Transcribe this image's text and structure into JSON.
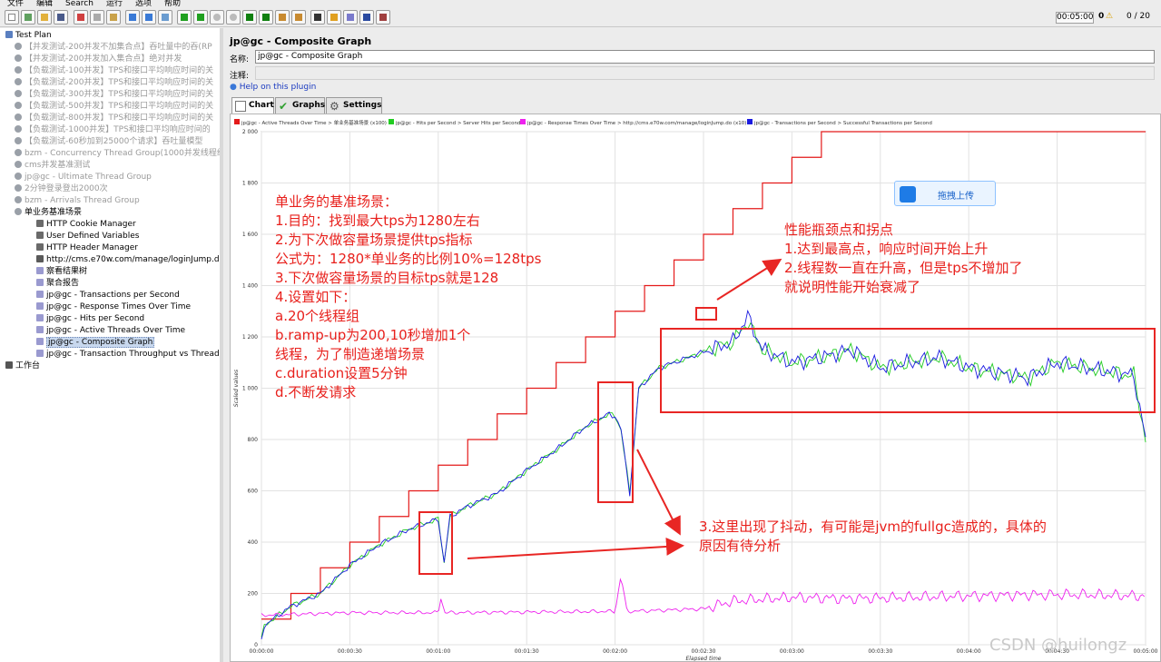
{
  "menu": [
    "文件",
    "编辑",
    "Search",
    "运行",
    "选项",
    "帮助"
  ],
  "toolbar": {
    "timer": "00:05:00",
    "warnings": "0",
    "threads": "0 / 20"
  },
  "tree": [
    {
      "label": "Test Plan",
      "indent": 0,
      "disabled": false,
      "icon": "test-plan-icon"
    },
    {
      "label": "【并发测试-200并发不加集合点】吞吐量中的吞(RP",
      "indent": 1,
      "disabled": true,
      "icon": "thread-group-icon"
    },
    {
      "label": "【并发测试-200并发加入集合点】绝对并发",
      "indent": 1,
      "disabled": true,
      "icon": "thread-group-icon"
    },
    {
      "label": "【负载测试-100并发】TPS和接口平均响应时间的关",
      "indent": 1,
      "disabled": true,
      "icon": "thread-group-icon"
    },
    {
      "label": "【负载测试-200并发】TPS和接口平均响应时间的关",
      "indent": 1,
      "disabled": true,
      "icon": "thread-group-icon"
    },
    {
      "label": "【负载测试-300并发】TPS和接口平均响应时间的关",
      "indent": 1,
      "disabled": true,
      "icon": "thread-group-icon"
    },
    {
      "label": "【负载测试-500并发】TPS和接口平均响应时间的关",
      "indent": 1,
      "disabled": true,
      "icon": "thread-group-icon"
    },
    {
      "label": "【负载测试-800并发】TPS和接口平均响应时间的关",
      "indent": 1,
      "disabled": true,
      "icon": "thread-group-icon"
    },
    {
      "label": "【负载测试-1000并发】TPS和接口平均响应时间的",
      "indent": 1,
      "disabled": true,
      "icon": "thread-group-icon"
    },
    {
      "label": "【负载测试-60秒加到25000个请求】吞吐量模型",
      "indent": 1,
      "disabled": true,
      "icon": "thread-group-icon"
    },
    {
      "label": "bzm - Concurrency Thread Group(1000并发线程组)",
      "indent": 1,
      "disabled": true,
      "icon": "thread-group-icon"
    },
    {
      "label": "cms并发基准测试",
      "indent": 1,
      "disabled": true,
      "icon": "thread-group-icon"
    },
    {
      "label": "jp@gc - Ultimate Thread Group",
      "indent": 1,
      "disabled": true,
      "icon": "thread-group-icon"
    },
    {
      "label": "2分钟登录登出2000次",
      "indent": 1,
      "disabled": true,
      "icon": "thread-group-icon"
    },
    {
      "label": "bzm - Arrivals Thread Group",
      "indent": 1,
      "disabled": true,
      "icon": "thread-group-icon"
    },
    {
      "label": "单业务基准场景",
      "indent": 1,
      "disabled": false,
      "icon": "thread-group-icon"
    },
    {
      "label": "HTTP Cookie Manager",
      "indent": 2,
      "disabled": false,
      "icon": "config-icon"
    },
    {
      "label": "User Defined Variables",
      "indent": 2,
      "disabled": false,
      "icon": "config-icon"
    },
    {
      "label": "HTTP Header Manager",
      "indent": 2,
      "disabled": false,
      "icon": "config-icon"
    },
    {
      "label": "http://cms.e70w.com/manage/loginJump.do",
      "indent": 2,
      "disabled": false,
      "icon": "sampler-icon"
    },
    {
      "label": "察看结果树",
      "indent": 2,
      "disabled": false,
      "icon": "listener-icon"
    },
    {
      "label": "聚合报告",
      "indent": 2,
      "disabled": false,
      "icon": "listener-icon"
    },
    {
      "label": "jp@gc - Transactions per Second",
      "indent": 2,
      "disabled": false,
      "icon": "listener-icon"
    },
    {
      "label": "jp@gc - Response Times Over Time",
      "indent": 2,
      "disabled": false,
      "icon": "listener-icon"
    },
    {
      "label": "jp@gc - Hits per Second",
      "indent": 2,
      "disabled": false,
      "icon": "listener-icon"
    },
    {
      "label": "jp@gc - Active Threads Over Time",
      "indent": 2,
      "disabled": false,
      "icon": "listener-icon"
    },
    {
      "label": "jp@gc - Composite Graph",
      "indent": 2,
      "disabled": false,
      "icon": "listener-icon",
      "selected": true
    },
    {
      "label": "jp@gc - Transaction Throughput vs Threads",
      "indent": 2,
      "disabled": false,
      "icon": "listener-icon"
    },
    {
      "label": "工作台",
      "indent": 0,
      "disabled": false,
      "icon": "workbench-icon"
    }
  ],
  "panel": {
    "title": "jp@gc - Composite Graph",
    "name_label": "名称:",
    "name_value": "jp@gc - Composite Graph",
    "comment_label": "注释:",
    "help": "Help on this plugin",
    "tabs": [
      "Chart",
      "Graphs",
      "Settings"
    ]
  },
  "chart_data": {
    "type": "line",
    "ylabel": "Scaled values",
    "xlabel": "Elapsed time",
    "ylim": [
      0,
      2000
    ],
    "yticks": [
      "0",
      "200",
      "400",
      "600",
      "800",
      "1 000",
      "1 200",
      "1 400",
      "1 600",
      "1 800",
      "2 000"
    ],
    "xticks": [
      "00:00:00",
      "00:00:30",
      "00:01:00",
      "00:01:30",
      "00:02:00",
      "00:02:30",
      "00:03:00",
      "00:03:30",
      "00:04:00",
      "00:04:30",
      "00:05:00"
    ],
    "xlim_seconds": [
      0,
      300
    ],
    "grid": true,
    "legend_placement": "top",
    "series": [
      {
        "name": "jp@gc - Active Threads Over Time > 单业务基准场景 (x100)",
        "color": "#e41a1a",
        "step_seconds": 10,
        "step_value": 100,
        "max_value": 2000
      },
      {
        "name": "jp@gc - Hits per Second > Server Hits per Second",
        "color": "#22cc22",
        "trend": [
          [
            0,
            20
          ],
          [
            1,
            75
          ],
          [
            10,
            150
          ],
          [
            20,
            200
          ],
          [
            30,
            310
          ],
          [
            40,
            390
          ],
          [
            50,
            450
          ],
          [
            60,
            490
          ],
          [
            62,
            320
          ],
          [
            64,
            500
          ],
          [
            70,
            540
          ],
          [
            80,
            590
          ],
          [
            90,
            680
          ],
          [
            100,
            760
          ],
          [
            110,
            850
          ],
          [
            118,
            900
          ],
          [
            120,
            890
          ],
          [
            122,
            840
          ],
          [
            125,
            590
          ],
          [
            128,
            1000
          ],
          [
            135,
            1080
          ],
          [
            145,
            1120
          ],
          [
            152,
            1150
          ],
          [
            160,
            1180
          ],
          [
            165,
            1260
          ],
          [
            170,
            1150
          ],
          [
            180,
            1100
          ],
          [
            190,
            1120
          ],
          [
            200,
            1150
          ],
          [
            210,
            1080
          ],
          [
            220,
            1100
          ],
          [
            230,
            1120
          ],
          [
            240,
            1080
          ],
          [
            250,
            1060
          ],
          [
            260,
            1040
          ],
          [
            270,
            1100
          ],
          [
            280,
            1080
          ],
          [
            290,
            1060
          ],
          [
            296,
            1050
          ],
          [
            300,
            800
          ]
        ]
      },
      {
        "name": "jp@gc - Response Times Over Time > http://cms.e70w.com/manage/loginJump.do (x10)",
        "color": "#ee22ee",
        "trend": [
          [
            0,
            115
          ],
          [
            30,
            125
          ],
          [
            60,
            125
          ],
          [
            61,
            190
          ],
          [
            62,
            125
          ],
          [
            120,
            130
          ],
          [
            122,
            270
          ],
          [
            124,
            130
          ],
          [
            150,
            140
          ],
          [
            160,
            170
          ],
          [
            180,
            185
          ],
          [
            200,
            180
          ],
          [
            220,
            185
          ],
          [
            240,
            190
          ],
          [
            260,
            195
          ],
          [
            280,
            195
          ],
          [
            300,
            190
          ]
        ]
      },
      {
        "name": "jp@gc - Transactions per Second > Successful Transactions per Second",
        "color": "#1a1ae0",
        "trend": [
          [
            0,
            20
          ],
          [
            1,
            75
          ],
          [
            10,
            150
          ],
          [
            20,
            200
          ],
          [
            30,
            310
          ],
          [
            40,
            390
          ],
          [
            50,
            450
          ],
          [
            60,
            490
          ],
          [
            62,
            320
          ],
          [
            64,
            500
          ],
          [
            70,
            540
          ],
          [
            80,
            590
          ],
          [
            90,
            680
          ],
          [
            100,
            760
          ],
          [
            110,
            850
          ],
          [
            118,
            900
          ],
          [
            120,
            890
          ],
          [
            122,
            840
          ],
          [
            125,
            590
          ],
          [
            128,
            1000
          ],
          [
            135,
            1080
          ],
          [
            145,
            1120
          ],
          [
            152,
            1150
          ],
          [
            160,
            1180
          ],
          [
            165,
            1280
          ],
          [
            170,
            1150
          ],
          [
            180,
            1100
          ],
          [
            190,
            1120
          ],
          [
            200,
            1150
          ],
          [
            210,
            1080
          ],
          [
            220,
            1100
          ],
          [
            230,
            1120
          ],
          [
            240,
            1080
          ],
          [
            250,
            1060
          ],
          [
            260,
            1040
          ],
          [
            270,
            1100
          ],
          [
            280,
            1080
          ],
          [
            290,
            1060
          ],
          [
            296,
            1050
          ],
          [
            300,
            800
          ]
        ]
      }
    ]
  },
  "annotations": {
    "left_lines": [
      "单业务的基准场景：",
      "1.目的：找到最大tps为1280左右",
      "2.为下次做容量场景提供tps指标",
      "公式为：1280*单业务的比例10%=128tps",
      "3.下次做容量场景的目标tps就是128",
      "4.设置如下：",
      "a.20个线程组",
      "b.ramp-up为200,10秒增加1个",
      "线程，为了制造递增场景",
      "c.duration设置5分钟",
      "d.不断发请求"
    ],
    "right_lines": [
      "性能瓶颈点和拐点",
      "1.达到最高点，响应时间开始上升",
      "2.线程数一直在升高，但是tps不增加了",
      "就说明性能开始衰减了"
    ],
    "bottom_lines": [
      "3.这里出现了抖动，有可能是jvm的fullgc造成的，具体的",
      "原因有待分析"
    ]
  },
  "upload_label": "拖拽上传",
  "watermark": "CSDN @huilongz"
}
